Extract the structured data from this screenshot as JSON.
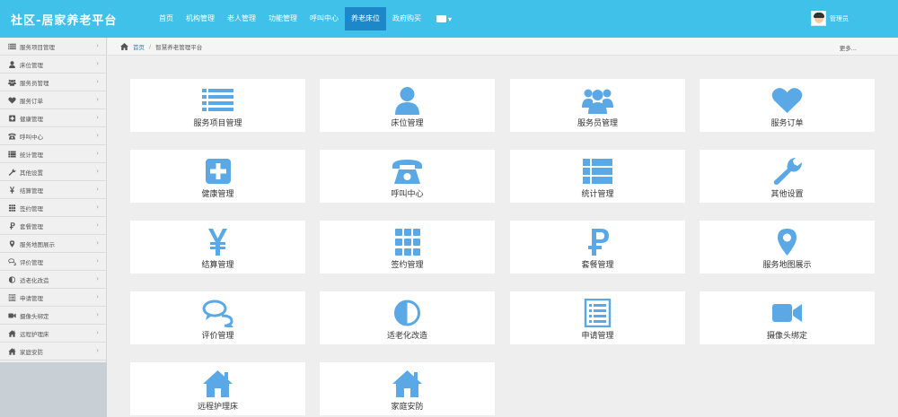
{
  "header": {
    "brand": "社区-居家养老平台",
    "nav": [
      "首页",
      "机构管理",
      "老人管理",
      "功能管理",
      "呼叫中心",
      "养老床位",
      "政府购买"
    ],
    "active_nav": "养老床位",
    "user": "管理员"
  },
  "breadcrumb": {
    "home": "首页",
    "current": "智慧养老管理平台",
    "more": "更多..."
  },
  "sidebar": {
    "items": [
      {
        "label": "服务项目管理",
        "icon": "list-icon"
      },
      {
        "label": "床位管理",
        "icon": "user-icon"
      },
      {
        "label": "服务员管理",
        "icon": "users-icon"
      },
      {
        "label": "服务订单",
        "icon": "heart-icon"
      },
      {
        "label": "健康管理",
        "icon": "plus-square-icon"
      },
      {
        "label": "呼叫中心",
        "icon": "phone-icon"
      },
      {
        "label": "统计管理",
        "icon": "th-list-icon"
      },
      {
        "label": "其他设置",
        "icon": "wrench-icon"
      },
      {
        "label": "结算管理",
        "icon": "yen-icon"
      },
      {
        "label": "签约管理",
        "icon": "grid-icon"
      },
      {
        "label": "套餐管理",
        "icon": "ruble-icon"
      },
      {
        "label": "服务地图展示",
        "icon": "map-marker-icon"
      },
      {
        "label": "评价管理",
        "icon": "comments-icon"
      },
      {
        "label": "适老化改造",
        "icon": "adjust-icon"
      },
      {
        "label": "申请管理",
        "icon": "list-alt-icon"
      },
      {
        "label": "摄像头绑定",
        "icon": "video-camera-icon"
      },
      {
        "label": "远程护理床",
        "icon": "home-icon"
      },
      {
        "label": "家庭安防",
        "icon": "home-icon"
      }
    ],
    "chevron": "›"
  },
  "tiles": [
    {
      "label": "服务项目管理",
      "icon": "list-icon"
    },
    {
      "label": "床位管理",
      "icon": "user-icon"
    },
    {
      "label": "服务员管理",
      "icon": "users-icon"
    },
    {
      "label": "服务订单",
      "icon": "heart-icon"
    },
    {
      "label": "健康管理",
      "icon": "plus-square-icon"
    },
    {
      "label": "呼叫中心",
      "icon": "phone-icon"
    },
    {
      "label": "统计管理",
      "icon": "th-list-icon"
    },
    {
      "label": "其他设置",
      "icon": "wrench-icon"
    },
    {
      "label": "结算管理",
      "icon": "yen-icon"
    },
    {
      "label": "签约管理",
      "icon": "grid-icon"
    },
    {
      "label": "套餐管理",
      "icon": "ruble-icon"
    },
    {
      "label": "服务地图展示",
      "icon": "map-marker-icon"
    },
    {
      "label": "评价管理",
      "icon": "comments-icon"
    },
    {
      "label": "适老化改造",
      "icon": "adjust-icon"
    },
    {
      "label": "申请管理",
      "icon": "list-alt-icon"
    },
    {
      "label": "摄像头绑定",
      "icon": "video-camera-icon"
    },
    {
      "label": "远程护理床",
      "icon": "home-icon"
    },
    {
      "label": "家庭安防",
      "icon": "home-icon"
    }
  ],
  "colors": {
    "topbar": "#3fc1ea",
    "active_nav": "#1e87c8",
    "icon": "#5aa9e6",
    "tile_bg": "#ffffff",
    "page_bg": "#eeeeee"
  }
}
